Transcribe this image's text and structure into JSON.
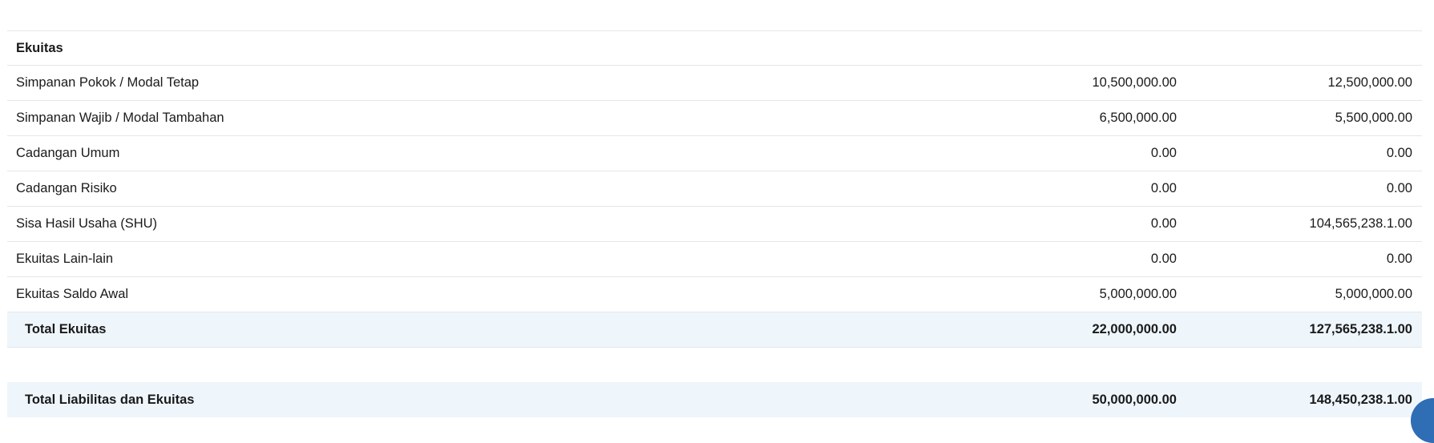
{
  "section": {
    "title": "Ekuitas"
  },
  "rows": [
    {
      "label": "Simpanan Pokok / Modal Tetap",
      "value_a": "10,500,000.00",
      "value_b": "12,500,000.00"
    },
    {
      "label": "Simpanan Wajib / Modal Tambahan",
      "value_a": "6,500,000.00",
      "value_b": "5,500,000.00"
    },
    {
      "label": "Cadangan Umum",
      "value_a": "0.00",
      "value_b": "0.00"
    },
    {
      "label": "Cadangan Risiko",
      "value_a": "0.00",
      "value_b": "0.00"
    },
    {
      "label": "Sisa Hasil Usaha (SHU)",
      "value_a": "0.00",
      "value_b": "104,565,238.1.00"
    },
    {
      "label": "Ekuitas Lain-lain",
      "value_a": "0.00",
      "value_b": "0.00"
    },
    {
      "label": "Ekuitas Saldo Awal",
      "value_a": "5,000,000.00",
      "value_b": "5,000,000.00"
    }
  ],
  "total_ekuitas": {
    "label": "Total Ekuitas",
    "value_a": "22,000,000.00",
    "value_b": "127,565,238.1.00"
  },
  "grand_total": {
    "label": "Total Liabilitas dan Ekuitas",
    "value_a": "50,000,000.00",
    "value_b": "148,450,238.1.00"
  },
  "colors": {
    "total_background": "#eef6fc",
    "divider": "#e6e6e6",
    "fab_accent": "#2f6db5"
  },
  "floating_button": {
    "icon": "floating-action-icon"
  }
}
